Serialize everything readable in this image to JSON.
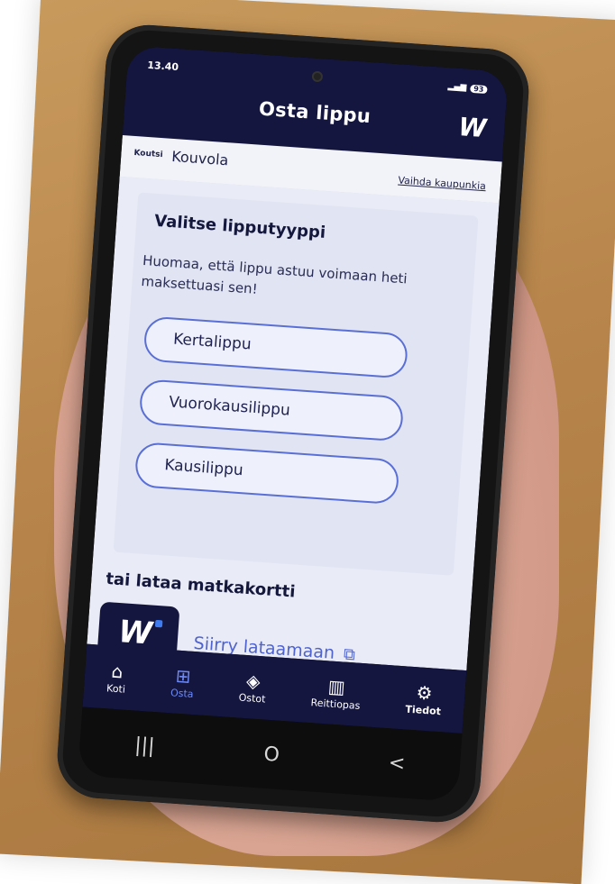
{
  "status": {
    "time": "13.40",
    "battery": "93"
  },
  "header": {
    "title": "Osta lippu",
    "logo": "W"
  },
  "city": {
    "label": "Koutsi",
    "value": "Kouvola",
    "change_link": "Vaihda kaupunkia"
  },
  "ticket_section": {
    "heading": "Valitse lipputyyppi",
    "note": "Huomaa, että lippu astuu voimaan heti maksettuasi sen!",
    "options": [
      "Kertalippu",
      "Vuorokausilippu",
      "Kausilippu"
    ]
  },
  "card_section": {
    "heading": "tai lataa matkakortti",
    "logo": "W",
    "link": "Siirry lataamaan",
    "link_icon": "external-link-icon"
  },
  "nav": {
    "items": [
      {
        "label": "Koti",
        "icon": "home-icon"
      },
      {
        "label": "Osta",
        "icon": "basket-icon"
      },
      {
        "label": "Ostot",
        "icon": "ticket-icon"
      },
      {
        "label": "Reittiopas",
        "icon": "map-icon"
      },
      {
        "label": "Tiedot",
        "icon": "gear-icon"
      }
    ],
    "active": "Osta"
  },
  "system_nav": {
    "recent": "|||",
    "home": "O",
    "back": "<"
  },
  "colors": {
    "primary": "#14163f",
    "accent": "#5a6fd6",
    "link": "#4e63cf"
  }
}
